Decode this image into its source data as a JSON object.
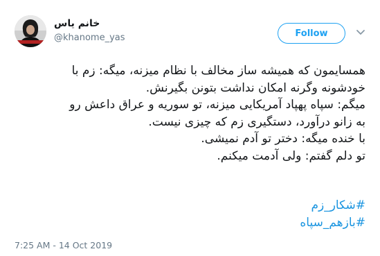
{
  "author": {
    "display_name": "خانم یاس",
    "handle": "@khanome_yas",
    "avatar_icon": "profile-photo"
  },
  "actions": {
    "follow_label": "Follow",
    "more_icon": "chevron-down-icon"
  },
  "tweet": {
    "lines": [
      "همسایمون که همیشه ساز مخالف با نظام میزنه، میگه: زم با",
      "خودشونه وگرنه امکان نداشت بتونن بگیرنش.",
      "میگم: سپاه پهپاد آمریکایی میزنه، تو سوریه و عراق داعش رو",
      "به زانو درآورد، دستگیری زم که چیزی نیست.",
      "با خنده میگه: دختر تو آدم نمیشی.",
      "تو دلم گفتم: ولی آدمت میکنم."
    ],
    "hashtags": [
      "#شکار_زم",
      "#بازهم_سپاه"
    ],
    "timestamp": "7:25 AM - 14 Oct 2019"
  },
  "colors": {
    "link": "#1b95e0",
    "follow": "#1da1f2",
    "secondary_text": "#657786",
    "primary_text": "#14171a"
  }
}
